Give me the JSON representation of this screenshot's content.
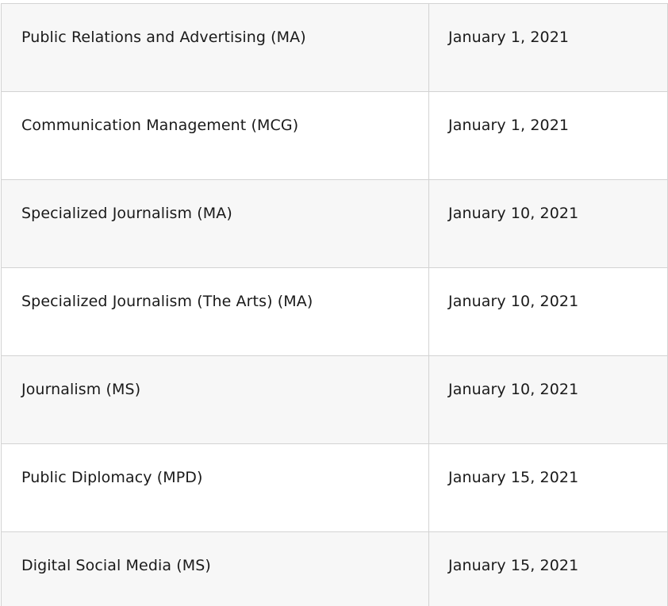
{
  "deadlines_table": {
    "rows": [
      {
        "program": "Public Relations and Advertising (MA)",
        "deadline": "January 1, 2021"
      },
      {
        "program": "Communication Management (MCG)",
        "deadline": "January 1, 2021"
      },
      {
        "program": "Specialized Journalism (MA)",
        "deadline": "January 10, 2021"
      },
      {
        "program": "Specialized Journalism (The Arts) (MA)",
        "deadline": "January 10, 2021"
      },
      {
        "program": "Journalism (MS)",
        "deadline": "January 10, 2021"
      },
      {
        "program": "Public Diplomacy (MPD)",
        "deadline": "January 15, 2021"
      },
      {
        "program": "Digital Social Media (MS)",
        "deadline": "January 15, 2021"
      }
    ],
    "colors": {
      "border": "#d3d3d3",
      "shaded_row": "#f7f7f7",
      "plain_row": "#ffffff",
      "text": "#1a1a1a"
    }
  }
}
